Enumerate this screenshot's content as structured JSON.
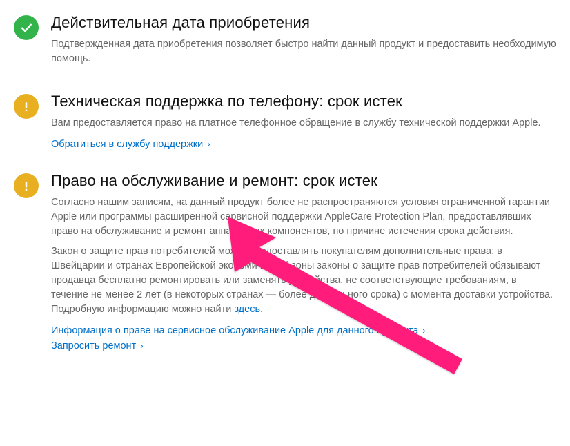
{
  "items": [
    {
      "status": "success",
      "title": "Действительная дата приобретения",
      "desc": "Подтвержденная дата приобретения позволяет быстро найти данный продукт и предоставить необходимую помощь."
    },
    {
      "status": "warning",
      "title": "Техническая поддержка по телефону: срок истек",
      "desc": "Вам предоставляется право на платное телефонное обращение в службу технической поддержки Apple.",
      "links": [
        {
          "text": "Обратиться в службу поддержки",
          "chev": "›"
        }
      ]
    },
    {
      "status": "warning",
      "title": "Право на обслуживание и ремонт: срок истек",
      "desc_parts": {
        "p1": "Согласно нашим записям, на данный продукт более не распространяются условия ограниченной гарантии Apple или программы расширенной сервисной поддержки AppleCare Protection Plan, предоставлявших право на обслуживание и ремонт аппаратных компонентов, по причине истечения срока действия.",
        "p2a": "Закон о защите прав потребителей может предоставлять покупателям дополнительные права: в Швейцарии и странах Европейской экономической зоны законы о защите прав потребителей обязывают продавца бесплатно ремонтировать или заменять устройства, не соответствующие требованиям, в течение не менее 2 лет (в некоторых странах — более длительного срока) с момента доставки устройства. Подробную информацию можно найти ",
        "p2link": "здесь",
        "p2b": "."
      },
      "links": [
        {
          "text": "Информация о праве на сервисное обслуживание Apple для данного продукта",
          "chev": "›"
        },
        {
          "text": "Запросить ремонт",
          "chev": "›"
        }
      ]
    }
  ],
  "colors": {
    "success": "#33b44a",
    "warning": "#e8b020",
    "link": "#0070c9",
    "arrow": "#ff1a7a"
  }
}
